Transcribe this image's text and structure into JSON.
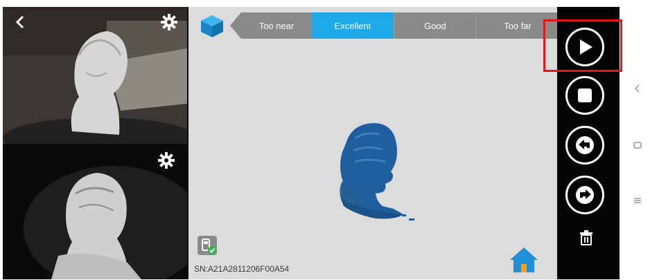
{
  "app_title": "",
  "colors": {
    "accent": "#1ea8e8",
    "range_inactive": "#8a8a8a",
    "model": "#1f5f9f",
    "highlight": "#e01818"
  },
  "camera_top": {
    "back_icon": "chevron-left-icon",
    "settings_icon": "gear-icon"
  },
  "camera_bottom": {
    "settings_icon": "gear-icon"
  },
  "range_bar": {
    "items": [
      {
        "label": "Too near",
        "active": false
      },
      {
        "label": "Excellent",
        "active": true
      },
      {
        "label": "Good",
        "active": false
      },
      {
        "label": "Too far",
        "active": false
      }
    ]
  },
  "status": {
    "serial": "SN:A21A2811206F00A54",
    "device_connected": true
  },
  "controls": {
    "play_icon": "play-icon",
    "stop_icon": "stop-icon",
    "undo_icon": "undo-icon",
    "redo_icon": "redo-icon",
    "delete_icon": "trash-icon"
  },
  "system_nav": {
    "back_icon": "nav-back-icon",
    "home_icon": "nav-home-icon",
    "menu_icon": "nav-menu-icon"
  }
}
